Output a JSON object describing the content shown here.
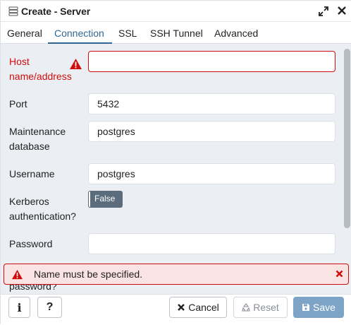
{
  "header": {
    "title": "Create - Server"
  },
  "tabs": [
    {
      "label": "General",
      "active": false
    },
    {
      "label": "Connection",
      "active": true
    },
    {
      "label": "SSL",
      "active": false
    },
    {
      "label": "SSH Tunnel",
      "active": false
    },
    {
      "label": "Advanced",
      "active": false
    }
  ],
  "form": {
    "host": {
      "label_line1": "Host",
      "label_line2": "name/address",
      "value": ""
    },
    "port": {
      "label": "Port",
      "value": "5432"
    },
    "maintenance_db": {
      "label_line1": "Maintenance",
      "label_line2": "database",
      "value": "postgres"
    },
    "username": {
      "label": "Username",
      "value": "postgres"
    },
    "kerberos": {
      "label_line1": "Kerberos",
      "label_line2": "authentication?",
      "value": "False"
    },
    "password": {
      "label": "Password",
      "value": ""
    },
    "partial_label": "password?"
  },
  "error_banner": {
    "message": "Name must be specified."
  },
  "footer": {
    "info_label": "i",
    "help_label": "?",
    "cancel_label": "Cancel",
    "reset_label": "Reset",
    "save_label": "Save"
  },
  "colors": {
    "accent": "#326690",
    "error": "#ce0d0d",
    "error_bg": "#fae3e3",
    "form_bg": "#ebeef3",
    "toggle_bg": "#5b6d7c",
    "save_bg": "#7da3c6"
  },
  "icons": {
    "server": "server-icon",
    "expand": "expand-icon",
    "close": "close-icon",
    "warning": "warning-icon",
    "cancel": "x-icon",
    "reset": "recycle-icon",
    "save": "floppy-icon"
  }
}
